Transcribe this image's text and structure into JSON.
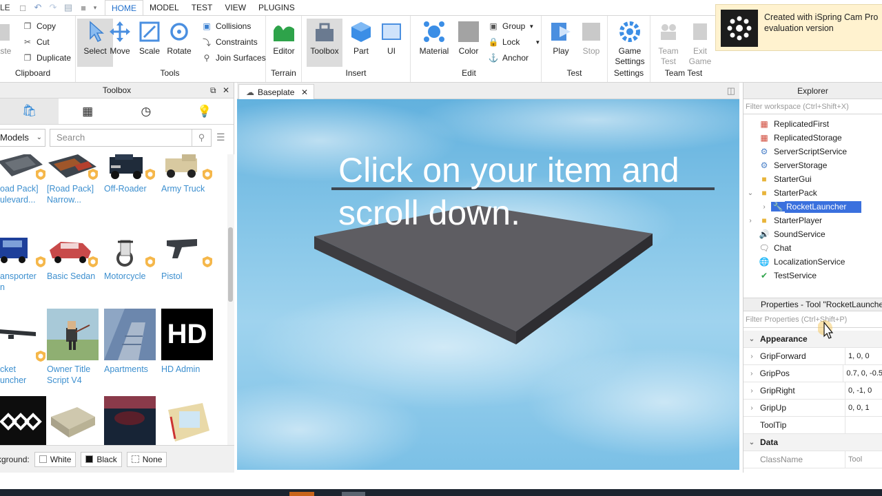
{
  "app": {
    "file_label": "LE"
  },
  "tabs": [
    "HOME",
    "MODEL",
    "TEST",
    "VIEW",
    "PLUGINS"
  ],
  "ribbon": {
    "clipboard": {
      "paste": "aste",
      "copy": "Copy",
      "cut": "Cut",
      "duplicate": "Duplicate",
      "label": "Clipboard"
    },
    "tools": {
      "select": "Select",
      "move": "Move",
      "scale": "Scale",
      "rotate": "Rotate",
      "collisions": "Collisions",
      "constraints": "Constraints",
      "join_surfaces": "Join Surfaces",
      "label": "Tools"
    },
    "terrain": {
      "editor": "Editor",
      "label": "Terrain"
    },
    "insert": {
      "toolbox": "Toolbox",
      "part": "Part",
      "ui": "UI",
      "label": "Insert"
    },
    "edit": {
      "material": "Material",
      "color": "Color",
      "group": "Group",
      "lock": "Lock",
      "anchor": "Anchor",
      "label": "Edit"
    },
    "test": {
      "play": "Play",
      "stop": "Stop",
      "label": "Test"
    },
    "settings": {
      "game": "Game",
      "settings_word": "Settings",
      "label": "Settings"
    },
    "team_test": {
      "team": "Team",
      "test": "Test",
      "exit": "Exit",
      "game": "Game",
      "label": "Team Test"
    }
  },
  "watermark": {
    "line1": "Created with iSpring Cam Pro",
    "line2": "evaluation version"
  },
  "toolbox": {
    "title": "Toolbox",
    "category": "Models",
    "search_placeholder": "Search",
    "items": [
      {
        "l1": "oad Pack]",
        "l2": "ulevard..."
      },
      {
        "l1": "[Road Pack]",
        "l2": "Narrow..."
      },
      {
        "l1": "Off-Roader",
        "l2": ""
      },
      {
        "l1": "Army Truck",
        "l2": ""
      },
      {
        "l1": "ansporter",
        "l2": "n"
      },
      {
        "l1": "Basic Sedan",
        "l2": ""
      },
      {
        "l1": "Motorcycle",
        "l2": ""
      },
      {
        "l1": "Pistol",
        "l2": ""
      },
      {
        "l1": "cket",
        "l2": "uncher"
      },
      {
        "l1": "Owner Title",
        "l2": "Script V4"
      },
      {
        "l1": "Apartments",
        "l2": ""
      },
      {
        "l1": "HD Admin",
        "l2": ""
      }
    ],
    "hd_text": "HD",
    "bg_label": "kground:",
    "bg_white": "White",
    "bg_black": "Black",
    "bg_none": "None"
  },
  "viewport": {
    "tab": "Baseplate",
    "overlay_line1": "Click on your item and",
    "overlay_line2": "scroll down."
  },
  "explorer": {
    "title": "Explorer",
    "filter": "Filter workspace (Ctrl+Shift+X)",
    "items": [
      "ReplicatedFirst",
      "ReplicatedStorage",
      "ServerScriptService",
      "ServerStorage",
      "StarterGui",
      "StarterPack",
      "RocketLauncher",
      "StarterPlayer",
      "SoundService",
      "Chat",
      "LocalizationService",
      "TestService"
    ]
  },
  "properties": {
    "title": "Properties - Tool \"RocketLauncher\"",
    "filter": "Filter Properties (Ctrl+Shift+P)",
    "appearance": "Appearance",
    "rows": [
      {
        "name": "GripForward",
        "value": "1, 0, 0"
      },
      {
        "name": "GripPos",
        "value": "0.7, 0, -0.5"
      },
      {
        "name": "GripRight",
        "value": "0, -1, 0"
      },
      {
        "name": "GripUp",
        "value": "0, 0, 1"
      },
      {
        "name": "ToolTip",
        "value": ""
      }
    ],
    "data_cat": "Data",
    "classname": {
      "name": "ClassName",
      "value": "Tool"
    }
  }
}
